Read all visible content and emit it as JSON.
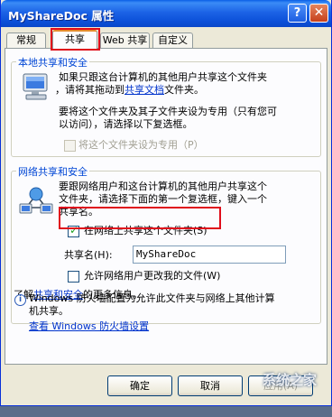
{
  "window": {
    "title": "MyShareDoc 属性",
    "help_label": "?",
    "close_label": "✕"
  },
  "tabs": [
    {
      "label": "常规"
    },
    {
      "label": "共享"
    },
    {
      "label": "Web 共享"
    },
    {
      "label": "自定义"
    }
  ],
  "local_share": {
    "legend": "本地共享和安全",
    "text_line1": "如果只跟这台计算机的其他用户共享这个文件夹",
    "text_line2_prefix": "，请将其拖动到",
    "text_line2_link": "共享文档",
    "text_line2_suffix": "文件夹。",
    "text2_line1": "要将这个文件夹及其子文件夹设为专用（只有您可",
    "text2_line2": "以访问），请选择以下复选框。",
    "private_checkbox_label": "将这个文件夹设为专用（P）"
  },
  "network_share": {
    "legend": "网络共享和安全",
    "text_line1": "要跟网络用户和这台计算机的其他用户共享这个",
    "text_line2": "文件夹，请选择下面的第一个复选框，键入一个",
    "text_line3": "共享名。",
    "share_checkbox_label": "在网络上共享这个文件夹(S)",
    "share_checked": true,
    "share_name_label": "共享名(H):",
    "share_name_value": "MyShareDoc",
    "allow_change_label": "允许网络用户更改我的文件(W)",
    "allow_change_checked": false,
    "learn_prefix": "了解",
    "learn_link": "共享和安全",
    "learn_suffix": "的更多信息。"
  },
  "firewall": {
    "info_icon": "i",
    "text_line1": "Windows 防火墙配置为允许此文件夹与网络上其他计算",
    "text_line2": "机共享。",
    "settings_link": "查看 Windows 防火墙设置"
  },
  "buttons": {
    "ok": "确定",
    "cancel": "取消",
    "apply": "应用(A)"
  },
  "watermark": "系统之家"
}
